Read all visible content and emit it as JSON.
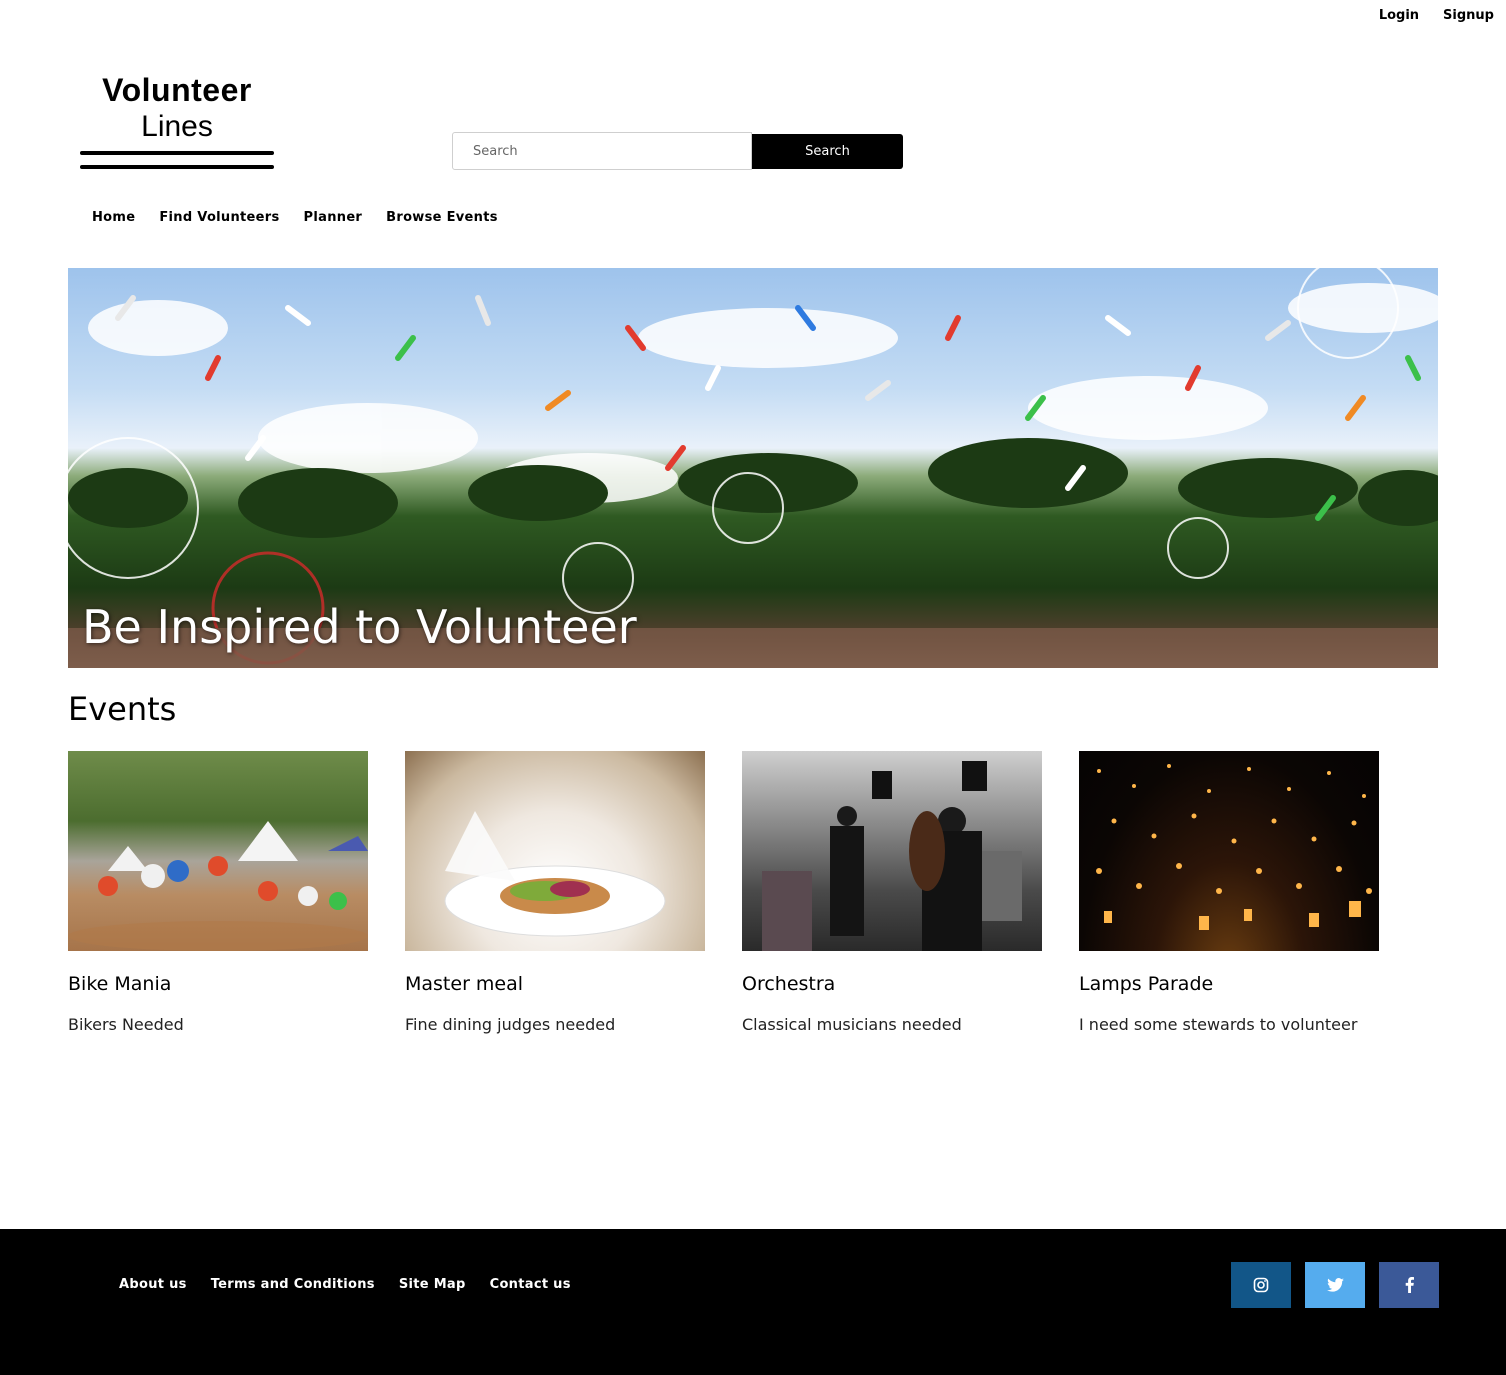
{
  "top_links": {
    "login": "Login",
    "signup": "Signup"
  },
  "logo": {
    "title": "Volunteer",
    "subtitle": "Lines"
  },
  "search": {
    "placeholder": "Search",
    "button_label": "Search"
  },
  "nav": {
    "items": [
      "Home",
      "Find Volunteers",
      "Planner",
      "Browse Events"
    ]
  },
  "hero": {
    "caption": "Be Inspired to Volunteer"
  },
  "events": {
    "heading": "Events",
    "cards": [
      {
        "title": "Bike Mania",
        "description": "Bikers Needed"
      },
      {
        "title": "Master meal",
        "description": "Fine dining judges needed"
      },
      {
        "title": "Orchestra",
        "description": "Classical musicians needed"
      },
      {
        "title": "Lamps Parade",
        "description": "I need some stewards to volunteer"
      }
    ]
  },
  "footer": {
    "links": [
      "About us",
      "Terms and Conditions",
      "Site Map",
      "Contact us"
    ],
    "social": [
      {
        "icon": "instagram-icon",
        "color": "#125688"
      },
      {
        "icon": "twitter-icon",
        "color": "#55acee"
      },
      {
        "icon": "facebook-icon",
        "color": "#3b5998"
      }
    ]
  }
}
